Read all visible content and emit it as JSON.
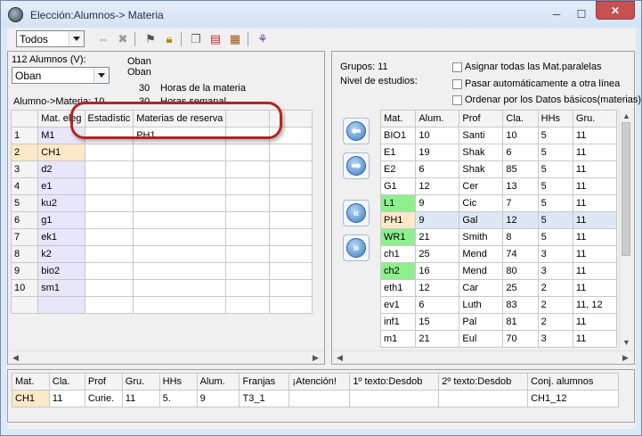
{
  "window": {
    "title": "Elección:Alumnos-> Materia"
  },
  "toolbar": {
    "filter_value": "Todos"
  },
  "left": {
    "student_count": "112 Alumnos (V):",
    "student_selected": "Oban",
    "name_1": "Oban",
    "name_2": "Oban",
    "hours_value_1": "30",
    "hours_label_1": "Horas de la materia",
    "hours_value_2": "30",
    "hours_label_2": "Horas semanal",
    "alumno_materia": "Alumno->Materia: 10",
    "columns": [
      "Mat. eleg",
      "Estadístic",
      "Materias de reserva",
      "",
      ""
    ],
    "rows": [
      {
        "num": "1",
        "mat": "M1",
        "reserva": "PH1"
      },
      {
        "num": "2",
        "mat": "CH1",
        "reserva": ""
      },
      {
        "num": "3",
        "mat": "d2",
        "reserva": ""
      },
      {
        "num": "4",
        "mat": "e1",
        "reserva": ""
      },
      {
        "num": "5",
        "mat": "ku2",
        "reserva": ""
      },
      {
        "num": "6",
        "mat": "g1",
        "reserva": ""
      },
      {
        "num": "7",
        "mat": "ek1",
        "reserva": ""
      },
      {
        "num": "8",
        "mat": "k2",
        "reserva": ""
      },
      {
        "num": "9",
        "mat": "bio2",
        "reserva": ""
      },
      {
        "num": "10",
        "mat": "sm1",
        "reserva": ""
      }
    ]
  },
  "right": {
    "groups": "Grupos: 11",
    "nivel": "Nivel de estudios:",
    "option_1": "Asignar todas las Mat.paralelas",
    "option_2": "Pasar automáticamente a otra línea",
    "option_3": "Ordenar por los Datos básicos(materias)",
    "columns": [
      "Mat.",
      "Alum.",
      "Prof",
      "Cla.",
      "HHs",
      "Gru."
    ],
    "rows": [
      [
        "BIO1",
        "10",
        "Santi",
        "10",
        "5",
        "11"
      ],
      [
        "E1",
        "19",
        "Shak",
        "6",
        "5",
        "11"
      ],
      [
        "E2",
        "6",
        "Shak",
        "85",
        "5",
        "11"
      ],
      [
        "G1",
        "12",
        "Cer",
        "13",
        "5",
        "11"
      ],
      [
        "L1",
        "9",
        "Cic",
        "7",
        "5",
        "11"
      ],
      [
        "PH1",
        "9",
        "Gal",
        "12",
        "5",
        "11"
      ],
      [
        "WR1",
        "21",
        "Smith",
        "8",
        "5",
        "11"
      ],
      [
        "ch1",
        "25",
        "Mend",
        "74",
        "3",
        "11"
      ],
      [
        "ch2",
        "16",
        "Mend",
        "80",
        "3",
        "11"
      ],
      [
        "eth1",
        "12",
        "Car",
        "25",
        "2",
        "11"
      ],
      [
        "ev1",
        "6",
        "Luth",
        "83",
        "2",
        "11, 12"
      ],
      [
        "inf1",
        "15",
        "Pal",
        "81",
        "2",
        "11"
      ],
      [
        "m1",
        "21",
        "Eul",
        "70",
        "3",
        "11"
      ]
    ]
  },
  "bottom": {
    "columns": [
      "Mat.",
      "Cla.",
      "Prof",
      "Gru.",
      "HHs",
      "Alum.",
      "Franjas",
      "¡Atención!",
      "1º texto:Desdob",
      "2º texto:Desdob",
      "Conj. alumnos"
    ],
    "row": [
      "CH1",
      "11",
      "Curie.",
      "11",
      "5.",
      "9",
      "T3_1",
      "",
      "",
      "",
      "CH1_12"
    ]
  },
  "colors": {
    "highlight_ring": "#b32424",
    "selected_cell": "#fde8c8",
    "green": "#8df08d"
  }
}
